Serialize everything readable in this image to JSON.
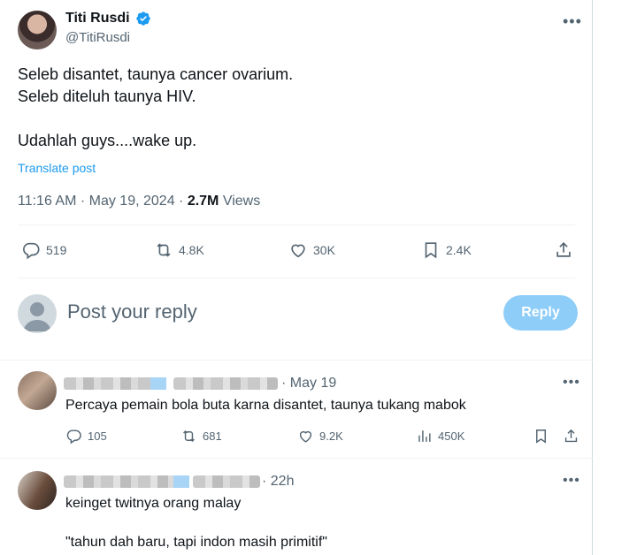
{
  "tweet": {
    "author_name": "Titi Rusdi",
    "author_handle": "@TitiRusdi",
    "text": "Seleb disantet, taunya cancer ovarium.\nSeleb diteluh taunya HIV.\n\nUdahlah guys....wake up.",
    "translate_label": "Translate post",
    "time": "11:16 AM · May 19, 2024 · ",
    "views_count": "2.7M",
    "views_label": " Views",
    "stats": {
      "replies": "519",
      "reposts": "4.8K",
      "likes": "30K",
      "bookmarks": "2.4K"
    }
  },
  "composer": {
    "placeholder": "Post your reply",
    "button_label": "Reply"
  },
  "replies": [
    {
      "time": "· May 19",
      "text": "Percaya pemain bola buta karna disantet, taunya tukang mabok",
      "stats": {
        "replies": "105",
        "reposts": "681",
        "likes": "9.2K",
        "views": "450K"
      }
    },
    {
      "time": "· 22h",
      "text": "keinget twitnya orang malay\n\n\"tahun dah baru, tapi indon masih primitif\""
    }
  ],
  "colors": {
    "accent": "#1d9bf0",
    "reply_button": "#8ecdf8",
    "muted": "#536471"
  },
  "icons": [
    "verified-badge-icon",
    "more-icon",
    "reply-icon",
    "repost-icon",
    "like-icon",
    "bookmark-icon",
    "share-icon",
    "views-icon"
  ]
}
